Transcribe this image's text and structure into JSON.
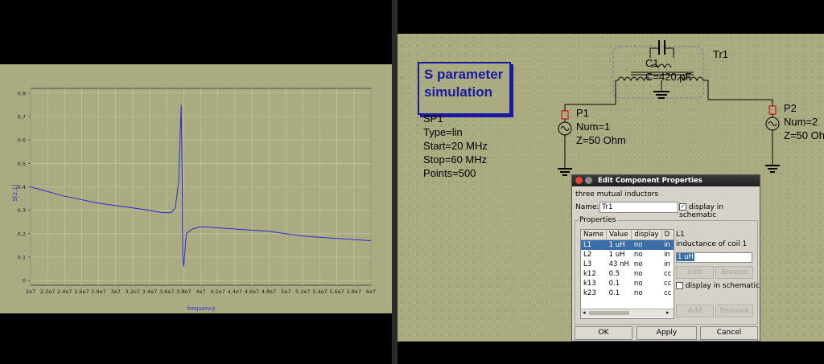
{
  "chart_data": {
    "type": "line",
    "xlabel": "frequency",
    "ylabel": "S[2,1]",
    "xlim": [
      20000000,
      60000000
    ],
    "ylim": [
      -0.02,
      0.82
    ],
    "xticks": [
      "2e7",
      "2.2e7",
      "2.4e7",
      "2.6e7",
      "2.8e7",
      "3e7",
      "3.2e7",
      "3.4e7",
      "3.6e7",
      "3.8e7",
      "4e7",
      "4.2e7",
      "4.4e7",
      "4.6e7",
      "4.8e7",
      "5e7",
      "5.2e7",
      "5.4e7",
      "5.6e7",
      "5.8e7",
      "6e7"
    ],
    "yticks": [
      "0",
      "0.1",
      "0.2",
      "0.3",
      "0.4",
      "0.5",
      "0.6",
      "0.7",
      "0.8"
    ],
    "grid": true,
    "series": [
      {
        "color": "#2b2bd6",
        "x": [
          20000000,
          24000000,
          28000000,
          32000000,
          34000000,
          35500000,
          36500000,
          37000000,
          37400000,
          37600000,
          37700000,
          37800000,
          37900000,
          38000000,
          38300000,
          39000000,
          40000000,
          44000000,
          48000000,
          52000000,
          56000000,
          60000000
        ],
        "y": [
          0.4,
          0.36,
          0.33,
          0.31,
          0.3,
          0.29,
          0.29,
          0.31,
          0.42,
          0.64,
          0.75,
          0.5,
          0.1,
          0.06,
          0.2,
          0.22,
          0.23,
          0.22,
          0.21,
          0.19,
          0.18,
          0.17
        ]
      }
    ]
  },
  "schematic": {
    "sp_title": [
      "S parameter",
      "simulation"
    ],
    "sp_props": [
      "SP1",
      "Type=lin",
      "Start=20 MHz",
      "Stop=60 MHz",
      "Points=500"
    ],
    "c1": [
      "C1",
      "C=420 pF"
    ],
    "tr1": "Tr1",
    "p1": [
      "P1",
      "Num=1",
      "Z=50 Ohm"
    ],
    "p2": [
      "P2",
      "Num=2",
      "Z=50 Oh"
    ]
  },
  "dialog": {
    "title": "Edit Component Properties",
    "description": "three mutual inductors",
    "name_label": "Name:",
    "name_value": "Tr1",
    "display_label": "display in schematic",
    "properties_label": "Properties",
    "columns": [
      "Name",
      "Value",
      "display",
      "D"
    ],
    "rows": [
      [
        "L1",
        "1 uH",
        "no",
        "in"
      ],
      [
        "L2",
        "1 uH",
        "no",
        "in"
      ],
      [
        "L3",
        "43 nH",
        "no",
        "in"
      ],
      [
        "k12",
        "0.5",
        "no",
        "cc"
      ],
      [
        "k13",
        "0.1",
        "no",
        "cc"
      ],
      [
        "k23",
        "0.1",
        "no",
        "cc"
      ]
    ],
    "prop_name": "L1",
    "prop_desc": "inductance of coil 1",
    "prop_value": "1 uH",
    "edit_label": "Edit",
    "browse_label": "Browse",
    "display_prop_label": "display in schematic",
    "add_label": "Add",
    "remove_label": "Remove",
    "ok_label": "OK",
    "apply_label": "Apply",
    "cancel_label": "Cancel"
  }
}
